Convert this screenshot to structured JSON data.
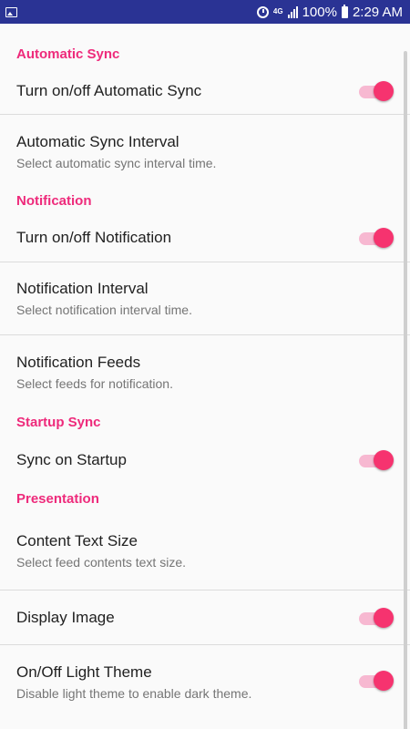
{
  "status_bar": {
    "network": "4G",
    "battery": "100%",
    "time": "2:29 AM"
  },
  "sections": {
    "automatic_sync": {
      "header": "Automatic Sync",
      "toggle": {
        "title": "Turn on/off Automatic Sync",
        "checked": true
      },
      "interval": {
        "title": "Automatic Sync Interval",
        "summary": "Select automatic sync interval time."
      }
    },
    "notification": {
      "header": "Notification",
      "toggle": {
        "title": "Turn on/off Notification",
        "checked": true
      },
      "interval": {
        "title": "Notification Interval",
        "summary": "Select notification interval time."
      },
      "feeds": {
        "title": "Notification Feeds",
        "summary": "Select feeds for notification."
      }
    },
    "startup_sync": {
      "header": "Startup Sync",
      "toggle": {
        "title": "Sync on Startup",
        "checked": true
      }
    },
    "presentation": {
      "header": "Presentation",
      "text_size": {
        "title": "Content Text Size",
        "summary": "Select feed contents text size."
      },
      "display_image": {
        "title": "Display Image",
        "checked": true
      },
      "light_theme": {
        "title": "On/Off Light Theme",
        "summary": "Disable light theme to enable dark theme.",
        "checked": true
      }
    }
  },
  "colors": {
    "accent": "#ee2a7b",
    "status_bar": "#2a3394",
    "switch_thumb": "#f6336f",
    "switch_track": "#f7b8d1"
  }
}
